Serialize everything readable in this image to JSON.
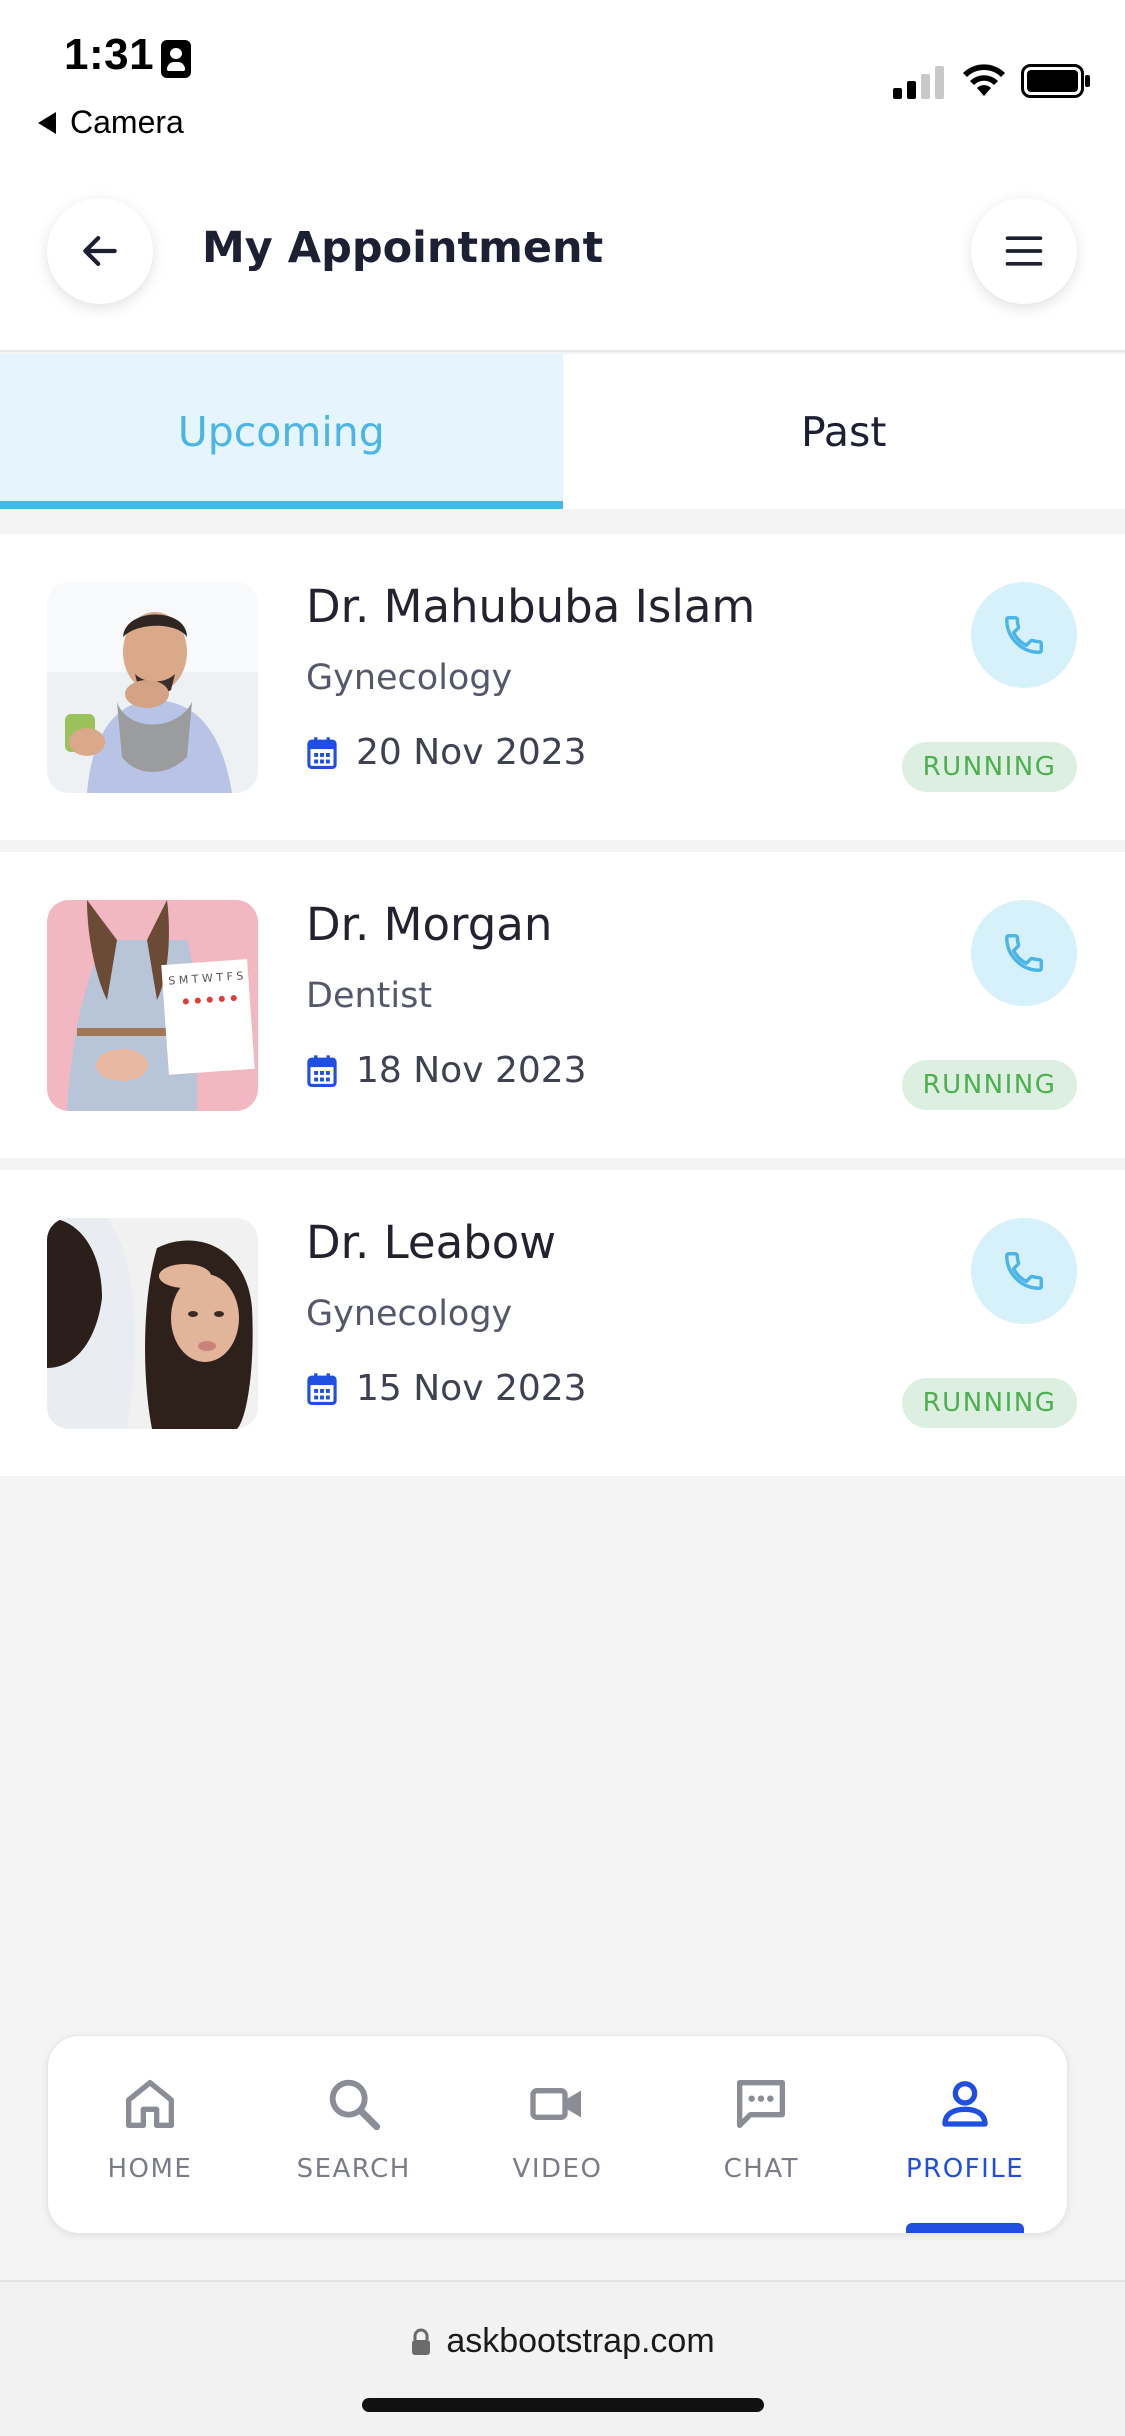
{
  "status_bar": {
    "time": "1:31",
    "back_app": "Camera"
  },
  "header": {
    "title": "My Appointment",
    "back_icon": "arrow-left-icon",
    "menu_icon": "hamburger-menu-icon"
  },
  "tabs": [
    {
      "label": "Upcoming",
      "active": true
    },
    {
      "label": "Past",
      "active": false
    }
  ],
  "appointments": [
    {
      "name": "Dr. Mahububa Islam",
      "specialty": "Gynecology",
      "date": "20 Nov 2023",
      "status": "RUNNING",
      "photo": "man-sick-scarf-photo"
    },
    {
      "name": "Dr. Morgan",
      "specialty": "Dentist",
      "date": "18 Nov 2023",
      "status": "RUNNING",
      "photo": "woman-calendar-photo"
    },
    {
      "name": "Dr. Leabow",
      "specialty": "Gynecology",
      "date": "15 Nov 2023",
      "status": "RUNNING",
      "photo": "woman-headache-photo"
    }
  ],
  "bottom_nav": [
    {
      "label": "HOME",
      "icon": "home-icon",
      "active": false
    },
    {
      "label": "SEARCH",
      "icon": "search-icon",
      "active": false
    },
    {
      "label": "VIDEO",
      "icon": "video-camera-icon",
      "active": false
    },
    {
      "label": "CHAT",
      "icon": "chat-icon",
      "active": false
    },
    {
      "label": "PROFILE",
      "icon": "person-icon",
      "active": true
    }
  ],
  "browser": {
    "url": "askbootstrap.com"
  },
  "colors": {
    "accent": "#4cb5e6",
    "nav_active": "#1f4fe0",
    "status_green": "#4caf50",
    "calendar_icon": "#1f4fe0"
  }
}
